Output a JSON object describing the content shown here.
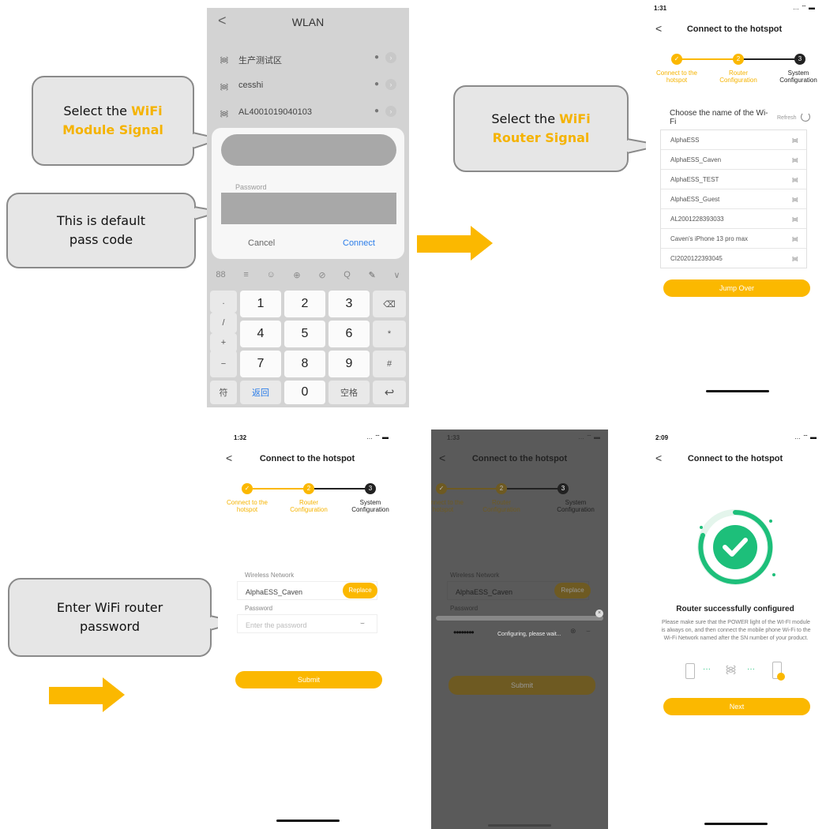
{
  "callouts": {
    "module": {
      "pre": "Select the ",
      "hl1": "WiFi",
      "hl2": "Module Signal"
    },
    "default": {
      "line1": "This is default",
      "line2": "pass code"
    },
    "router": {
      "pre": "Select the ",
      "hl1": "WiFi",
      "hl2": "Router Signal"
    },
    "enter": {
      "line1": "Enter WiFi router",
      "line2": "password"
    }
  },
  "colors": {
    "accent": "#fbb800",
    "highlight": "#f5b300",
    "success": "#1dbf7a"
  },
  "wlan": {
    "back_icon": "chevron-left-icon",
    "title": "WLAN",
    "networks": [
      {
        "name": "生产测试区"
      },
      {
        "name": "cesshi"
      },
      {
        "name": "AL4001019040103"
      }
    ],
    "password_label": "Password",
    "cancel": "Cancel",
    "connect": "Connect",
    "toolbar": [
      "88",
      "≡",
      "☺",
      "⊕",
      "⊘",
      "Q",
      "✎",
      "∨"
    ],
    "keys": {
      "side_left": [
        ".",
        "/",
        "+",
        "−",
        "符"
      ],
      "digits": [
        "1",
        "2",
        "3",
        "4",
        "5",
        "6",
        "7",
        "8",
        "9"
      ],
      "side_right": [
        "⌫",
        "*",
        "#",
        "↩"
      ],
      "bottom": [
        "返回",
        "0",
        "空格"
      ]
    }
  },
  "router_screen": {
    "time": "1:31",
    "title": "Connect to the hotspot",
    "steps": [
      {
        "num": "1",
        "label": "Connect to the hotspot"
      },
      {
        "num": "2",
        "label": "Router Configuration"
      },
      {
        "num": "3",
        "label": "System Configuration"
      }
    ],
    "choose_label": "Choose the name of the Wi-Fi",
    "refresh": "Refresh",
    "networks": [
      "AlphaESS",
      "AlphaESS_Caven",
      "AlphaESS_TEST",
      "AlphaESS_Guest",
      "AL2001228393033",
      "Caven's iPhone 13 pro max",
      "CI2020122393045"
    ],
    "jump_over": "Jump Over"
  },
  "pw_screen": {
    "time": "1:32",
    "title": "Connect to the hotspot",
    "wireless_label": "Wireless Network",
    "network": "AlphaESS_Caven",
    "replace": "Replace",
    "password_label": "Password",
    "password_placeholder": "Enter the password",
    "submit": "Submit"
  },
  "config_screen": {
    "time": "1:33",
    "title": "Connect to the hotspot",
    "wireless_label": "Wireless Network",
    "network": "AlphaESS_Caven",
    "replace": "Replace",
    "password_label": "Password",
    "password_value": "••••••••",
    "loading": "Configuring, please wait...",
    "submit": "Submit"
  },
  "success_screen": {
    "time": "2:09",
    "title": "Connect to the hotspot",
    "heading": "Router successfully configured",
    "body": "Please make sure that the POWER light of the WI-FI module is always on, and then connect the mobile phone Wi-Fi to the Wi-Fi Network named after the SN number of your product.",
    "next": "Next"
  }
}
